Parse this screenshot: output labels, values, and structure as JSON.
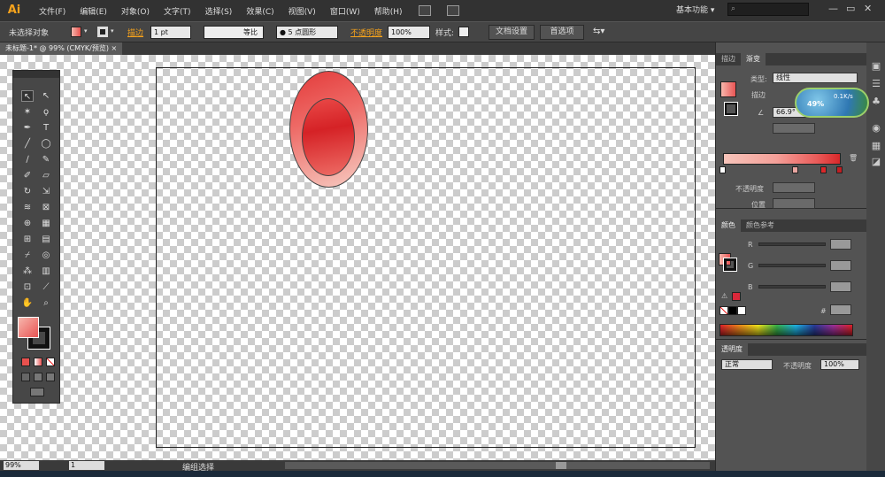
{
  "app": {
    "logo": "Ai",
    "workspace": "基本功能",
    "workspace_arrow": "▾"
  },
  "menu": [
    "文件(F)",
    "编辑(E)",
    "对象(O)",
    "文字(T)",
    "选择(S)",
    "效果(C)",
    "视图(V)",
    "窗口(W)",
    "帮助(H)"
  ],
  "window_controls": [
    "—",
    "▭",
    "✕"
  ],
  "control": {
    "no_selection": "未选择对象",
    "stroke_label": "描边",
    "stroke_weight": "1 pt",
    "uniform_label": "等比",
    "brush": "● 5 点圆形",
    "opacity_label": "不透明度",
    "opacity_value": "100%",
    "style_label": "样式:",
    "doc_setup": "文档设置",
    "preferences": "首选项"
  },
  "doc_tab": {
    "title": "未标题-1* @ 99% (CMYK/预览)",
    "close": "×"
  },
  "status": {
    "zoom": "99%",
    "page": "1",
    "tool": "编组选择"
  },
  "gradient_panel": {
    "tabs": [
      "描边",
      "渐变"
    ],
    "type_label": "类型:",
    "type_value": "线性",
    "stroke_label": "描边",
    "angle_value": "66.9°",
    "opacity_label": "不透明度",
    "position_label": "位置",
    "stop_colors": [
      "#ffffff",
      "#e8a5a0",
      "#d9282a",
      "#c01e22"
    ]
  },
  "net_widget": {
    "speed": "0.1K/s",
    "percent": "49%"
  },
  "color_panel": {
    "tabs": [
      "颜色",
      "颜色参考"
    ],
    "r_label": "R",
    "g_label": "G",
    "b_label": "B",
    "hex_label": "#"
  },
  "transparency_panel": {
    "title": "透明度",
    "mode": "正常",
    "opacity_label": "不透明度",
    "opacity_value": "100%"
  },
  "colors": {
    "gradient_start": "#f7b7ad",
    "gradient_end": "#e85454",
    "accent_orange": "#f7a31c"
  }
}
